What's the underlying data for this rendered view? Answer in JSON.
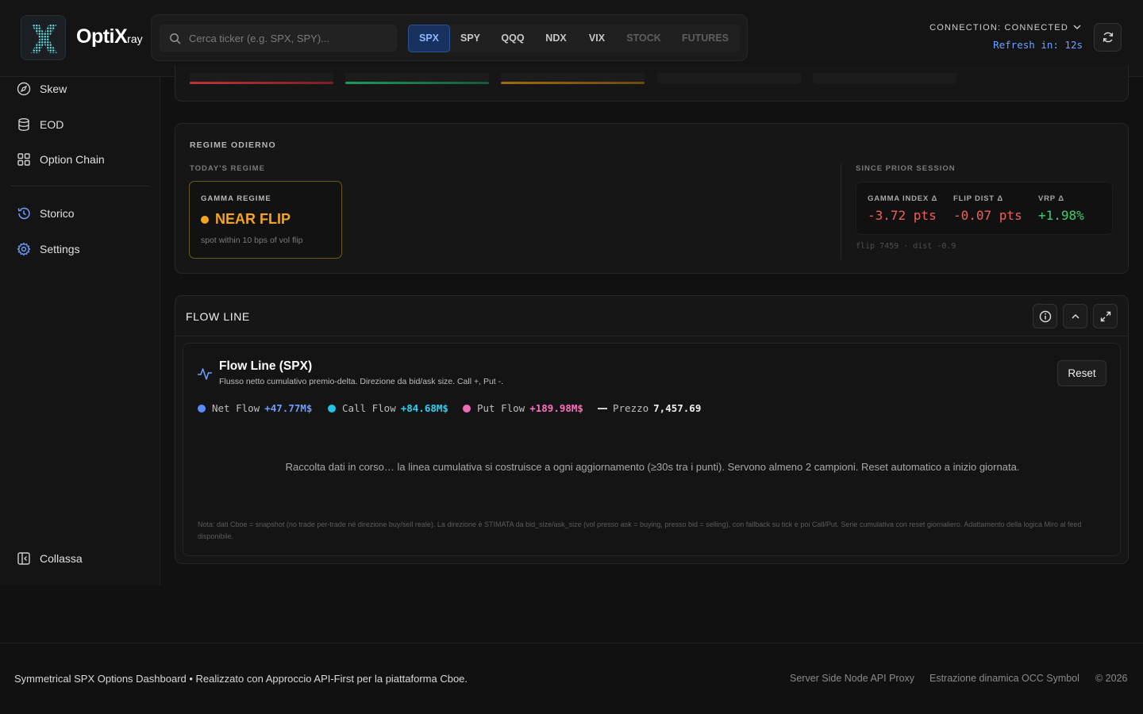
{
  "header": {
    "logo_main": "OptiX",
    "logo_suffix": "ray",
    "search_placeholder": "Cerca ticker (e.g. SPX, SPY)...",
    "tabs": [
      {
        "label": "SPX",
        "state": "active"
      },
      {
        "label": "SPY",
        "state": "normal"
      },
      {
        "label": "QQQ",
        "state": "normal"
      },
      {
        "label": "NDX",
        "state": "normal"
      },
      {
        "label": "VIX",
        "state": "normal"
      },
      {
        "label": "STOCK",
        "state": "disabled"
      },
      {
        "label": "FUTURES",
        "state": "disabled"
      }
    ],
    "connection_label": "CONNECTION: CONNECTED",
    "refresh_text": "Refresh in: 12s"
  },
  "sidebar": {
    "items": [
      {
        "label": "Skew",
        "icon": "compass-icon"
      },
      {
        "label": "EOD",
        "icon": "database-icon"
      },
      {
        "label": "Option Chain",
        "icon": "grid-icon"
      },
      {
        "label": "Storico",
        "icon": "history-icon"
      },
      {
        "label": "Settings",
        "icon": "gear-icon"
      }
    ],
    "collapse_label": "Collassa"
  },
  "regime": {
    "title": "REGIME ODIERNO",
    "today_label": "TODAY'S REGIME",
    "gamma_label": "GAMMA REGIME",
    "gamma_value": "NEAR FLIP",
    "gamma_note": "spot within 10 bps of vol flip",
    "since_label": "SINCE PRIOR SESSION",
    "metrics": [
      {
        "label": "GAMMA INDEX Δ",
        "value": "-3.72 pts",
        "color": "#f0605a"
      },
      {
        "label": "FLIP DIST Δ",
        "value": "-0.07 pts",
        "color": "#f0605a"
      },
      {
        "label": "VRP Δ",
        "value": "+1.98%",
        "color": "#3fcf6f"
      }
    ],
    "since_footnote": "flip 7459 · dist -0.9"
  },
  "flow": {
    "section_title": "FLOW LINE",
    "card_title": "Flow Line (SPX)",
    "card_subtitle": "Flusso netto cumulativo premio-delta. Direzione da bid/ask size. Call +, Put -.",
    "reset_label": "Reset",
    "legend": [
      {
        "label": "Net Flow",
        "value": "+47.77M$",
        "color": "#5b8cff"
      },
      {
        "label": "Call Flow",
        "value": "+84.68M$",
        "color": "#23c2e8"
      },
      {
        "label": "Put Flow",
        "value": "+189.98M$",
        "color": "#f06cb8"
      }
    ],
    "price_label": "Prezzo",
    "price_value": "7,457.69",
    "collecting_message": "Raccolta dati in corso… la linea cumulativa si costruisce a ogni aggiornamento (≥30s tra i punti). Servono almeno 2 campioni. Reset automatico a inizio giornata.",
    "note": "Nota: dati Cboe = snapshot (no trade per-trade né direzione buy/sell reale). La direzione è STIMATA da bid_size/ask_size (vol presso ask = buying, presso bid = selling), con fallback su tick e poi Call/Put. Serie cumulativa con reset giornaliero. Adattamento della logica Miro al feed disponibile."
  },
  "footer": {
    "left_text": "Symmetrical SPX Options Dashboard • Realizzato con Approccio API-First per la piattaforma Cboe.",
    "link1": "Server Side Node API Proxy",
    "link2": "Estrazione dinamica OCC Symbol",
    "copyright": "© 2026"
  },
  "colors": {
    "accent": "#6fa0ff",
    "warning": "#f4a520",
    "negative": "#f0605a",
    "positive": "#3fcf6f"
  }
}
